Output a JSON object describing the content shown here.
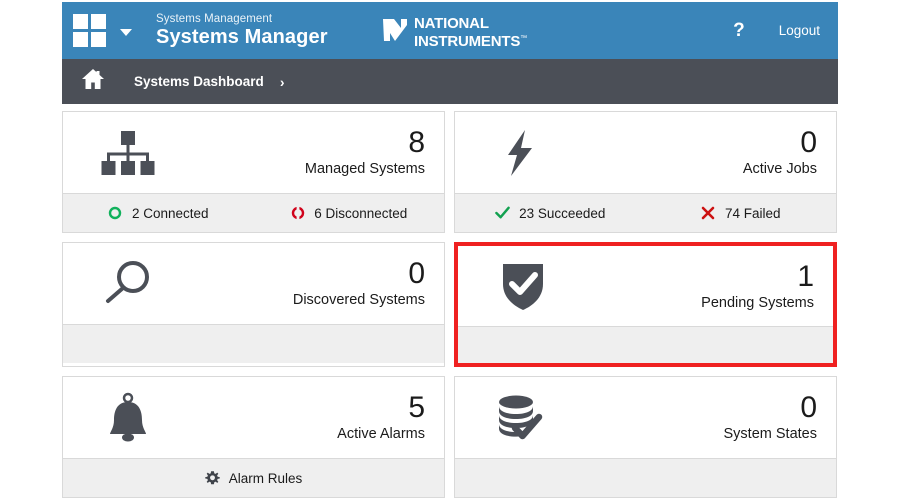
{
  "header": {
    "app_kicker": "Systems Management",
    "app_title": "Systems Manager",
    "brand_line1": "NATIONAL",
    "brand_line2": "INSTRUMENTS",
    "brand_tm": "™",
    "help_label": "?",
    "logout_label": "Logout",
    "menu_icon": "grid-icon",
    "dropdown_icon": "chevron-down-icon",
    "bg_color": "#3a85b9"
  },
  "breadcrumb": {
    "home_icon": "home-icon",
    "current": "Systems Dashboard",
    "separator": "›",
    "bg_color": "#4b4f57"
  },
  "tiles": [
    {
      "id": "managed-systems",
      "icon": "network-hierarchy-icon",
      "count": "8",
      "label": "Managed Systems",
      "highlighted": false,
      "footer": [
        {
          "icon": "circle-connected-icon",
          "icon_color": "#11b15c",
          "text": "2 Connected"
        },
        {
          "icon": "circle-disconnected-icon",
          "icon_color": "#d0021b",
          "text": "6 Disconnected"
        }
      ]
    },
    {
      "id": "active-jobs",
      "icon": "lightning-bolt-icon",
      "count": "0",
      "label": "Active Jobs",
      "highlighted": false,
      "footer": [
        {
          "icon": "check-icon",
          "icon_color": "#12a150",
          "text": "23 Succeeded"
        },
        {
          "icon": "x-icon",
          "icon_color": "#cc1111",
          "text": "74 Failed"
        }
      ]
    },
    {
      "id": "discovered-systems",
      "icon": "magnifier-icon",
      "count": "0",
      "label": "Discovered Systems",
      "highlighted": false,
      "footer": []
    },
    {
      "id": "pending-systems",
      "icon": "shield-check-icon",
      "count": "1",
      "label": "Pending Systems",
      "highlighted": true,
      "highlight_color": "#ef2121",
      "footer": []
    },
    {
      "id": "active-alarms",
      "icon": "bell-icon",
      "count": "5",
      "label": "Active Alarms",
      "highlighted": false,
      "footer": [
        {
          "icon": "gear-icon",
          "icon_color": "#4b4f57",
          "text": "Alarm Rules"
        }
      ]
    },
    {
      "id": "system-states",
      "icon": "database-check-icon",
      "count": "0",
      "label": "System States",
      "highlighted": false,
      "footer": []
    }
  ]
}
